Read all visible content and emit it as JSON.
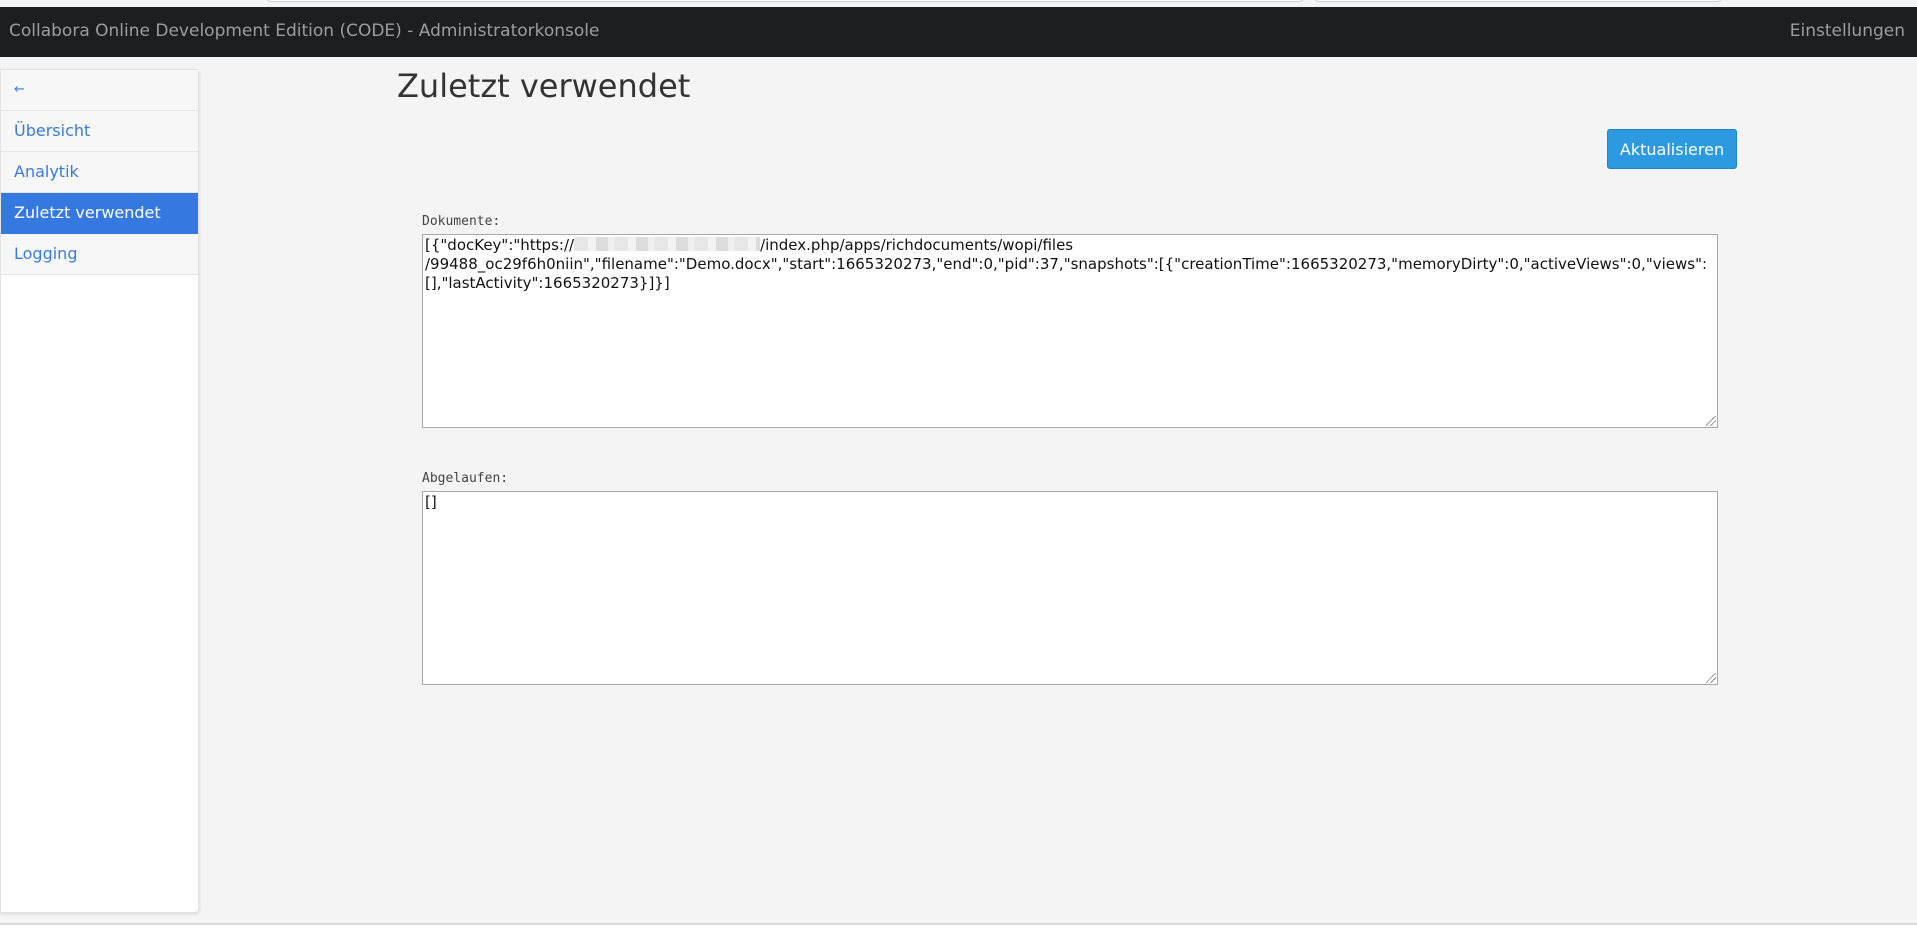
{
  "navbar": {
    "title": "Collabora Online Development Edition (CODE) - Administratorkonsole",
    "settings_label": "Einstellungen"
  },
  "sidebar": {
    "back_icon": "←",
    "items": [
      {
        "label": "Übersicht"
      },
      {
        "label": "Analytik"
      },
      {
        "label": "Zuletzt verwendet",
        "active": true
      },
      {
        "label": "Logging"
      }
    ]
  },
  "main": {
    "title": "Zuletzt verwendet",
    "refresh_label": "Aktualisieren",
    "documents": {
      "label": "Dokumente:",
      "line1_prefix": "[{\"docKey\":\"https://",
      "line1_suffix": "/index.php/apps/richdocuments/wopi/files",
      "line2": "/99488_oc29f6h0niin\",\"filename\":\"Demo.docx\",\"start\":1665320273,\"end\":0,\"pid\":37,\"snapshots\":[{\"creationTime\":1665320273,\"memoryDirty\":0,\"activeViews\":0,\"views\":",
      "line3": "[],\"lastActivity\":1665320273}]}]"
    },
    "expired": {
      "label": "Abgelaufen:",
      "value": "[]"
    }
  },
  "colors": {
    "navbar_bg": "#1c1e21",
    "accent": "#3478e0",
    "button": "#2c9ae0",
    "link": "#3a7bd5"
  }
}
